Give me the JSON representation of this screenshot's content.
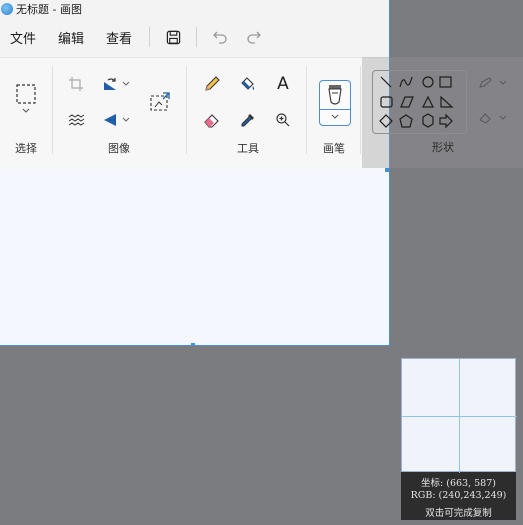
{
  "window": {
    "title": "无标题 - 画图"
  },
  "menu": {
    "items": [
      "文件",
      "编辑",
      "查看"
    ]
  },
  "ribbon": {
    "groups": {
      "select": "选择",
      "image": "图像",
      "tools": "工具",
      "brushes": "画笔",
      "shapes": "形状"
    },
    "tools_text_glyph": "A"
  },
  "magnifier": {
    "coords": "坐标: (663, 587)",
    "rgb": "RGB: (240,243,249)",
    "hint": "双击可完成复制"
  },
  "colors": {
    "accent": "#4a8fd0",
    "canvas": "#f4f7fd",
    "background": "#7b7c80"
  }
}
